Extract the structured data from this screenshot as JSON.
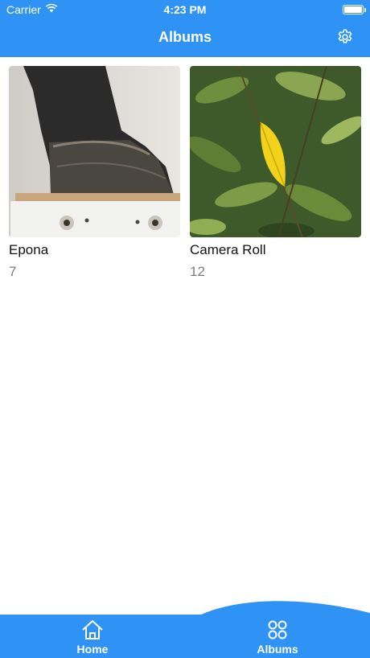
{
  "status_bar": {
    "carrier": "Carrier",
    "time": "4:23 PM"
  },
  "nav": {
    "title": "Albums"
  },
  "albums": [
    {
      "name": "Epona",
      "count": "7"
    },
    {
      "name": "Camera Roll",
      "count": "12"
    }
  ],
  "tabbar": {
    "home_label": "Home",
    "albums_label": "Albums",
    "active_tab": "Albums"
  },
  "colors": {
    "accent": "#2e93f4",
    "count_text": "#7b7b7b"
  },
  "icons": {
    "settings": "gear-icon",
    "home_tab": "home-icon",
    "albums_tab": "grid-dots-icon"
  }
}
